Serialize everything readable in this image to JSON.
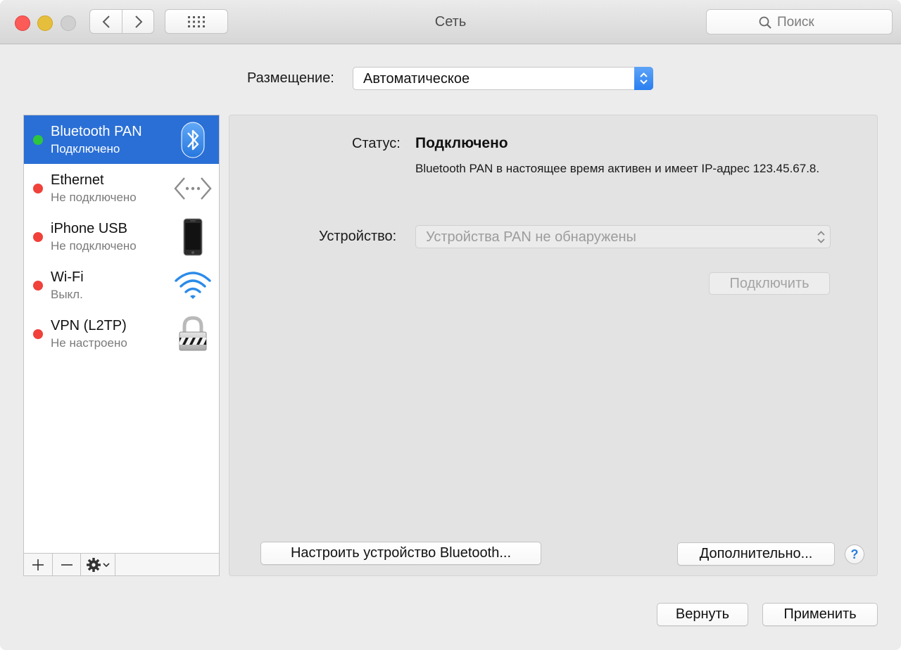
{
  "window": {
    "title": "Сеть",
    "search_placeholder": "Поиск"
  },
  "location": {
    "label": "Размещение:",
    "value": "Автоматическое"
  },
  "services": [
    {
      "name": "Bluetooth PAN",
      "status": "Подключено",
      "state_color": "#2dc53e",
      "icon": "bluetooth-icon",
      "selected": true
    },
    {
      "name": "Ethernet",
      "status": "Не подключено",
      "state_color": "#f0413a",
      "icon": "ethernet-icon",
      "selected": false
    },
    {
      "name": "iPhone USB",
      "status": "Не подключено",
      "state_color": "#f0413a",
      "icon": "iphone-icon",
      "selected": false
    },
    {
      "name": "Wi-Fi",
      "status": "Выкл.",
      "state_color": "#f0413a",
      "icon": "wifi-icon",
      "selected": false
    },
    {
      "name": "VPN (L2TP)",
      "status": "Не настроено",
      "state_color": "#f0413a",
      "icon": "vpn-lock-icon",
      "selected": false
    }
  ],
  "detail": {
    "status_label": "Статус:",
    "status_value": "Подключено",
    "status_description": "Bluetooth PAN в настоящее время активен и имеет IP-адрес 123.45.67.8.",
    "device_label": "Устройство:",
    "device_value": "Устройства PAN не обнаружены",
    "connect_button": "Подключить",
    "bluetooth_setup_button": "Настроить устройство Bluetooth...",
    "advanced_button": "Дополнительно...",
    "help_button": "?"
  },
  "footer": {
    "revert_button": "Вернуть",
    "apply_button": "Применить"
  },
  "colors": {
    "selection": "#2a6fd6",
    "connected": "#2dc53e",
    "disconnected": "#f0413a",
    "accent": "#2a7ff0"
  }
}
